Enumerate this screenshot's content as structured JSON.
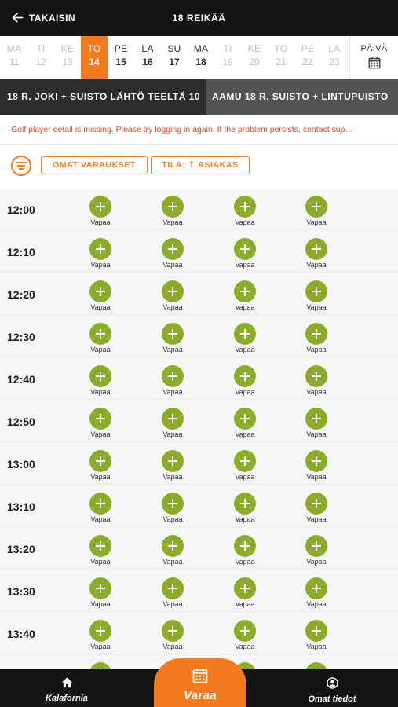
{
  "header": {
    "back_label": "TAKAISIN",
    "title": "18 REIKÄÄ"
  },
  "dates": [
    {
      "day": "MA",
      "date": "11",
      "state": "past"
    },
    {
      "day": "TI",
      "date": "12",
      "state": "past"
    },
    {
      "day": "KE",
      "date": "13",
      "state": "past"
    },
    {
      "day": "TO",
      "date": "14",
      "state": "selected"
    },
    {
      "day": "PE",
      "date": "15",
      "state": "now"
    },
    {
      "day": "LA",
      "date": "16",
      "state": "now"
    },
    {
      "day": "SU",
      "date": "17",
      "state": "now"
    },
    {
      "day": "MA",
      "date": "18",
      "state": "now"
    },
    {
      "day": "TI",
      "date": "19",
      "state": "fut"
    },
    {
      "day": "KE",
      "date": "20",
      "state": "fut"
    },
    {
      "day": "TO",
      "date": "21",
      "state": "fut"
    },
    {
      "day": "PE",
      "date": "22",
      "state": "fut"
    },
    {
      "day": "LA",
      "date": "23",
      "state": "fut"
    }
  ],
  "day_picker_label": "PÄIVÄ",
  "tabs": [
    {
      "label": "18 R. JOKI + SUISTO LÄHTÖ TEELTÄ 10",
      "active": true
    },
    {
      "label": "AAMU 18 R. SUISTO + LINTUPUISTO",
      "active": false
    }
  ],
  "error_message": "Golf player detail is missing. Please try logging in again. If the problem persists, contact sup…",
  "filters": {
    "my_bookings": "OMAT VARAUKSET",
    "status": "TILA: ⇡ ASIAKAS"
  },
  "slot_label": "Vapaa",
  "slots": [
    {
      "time": "12:00",
      "spots": [
        "Vapaa",
        "Vapaa",
        "Vapaa",
        "Vapaa"
      ]
    },
    {
      "time": "12:10",
      "spots": [
        "Vapaa",
        "Vapaa",
        "Vapaa",
        "Vapaa"
      ]
    },
    {
      "time": "12:20",
      "spots": [
        "Vapaa",
        "Vapaa",
        "Vapaa",
        "Vapaa"
      ]
    },
    {
      "time": "12:30",
      "spots": [
        "Vapaa",
        "Vapaa",
        "Vapaa",
        "Vapaa"
      ]
    },
    {
      "time": "12:40",
      "spots": [
        "Vapaa",
        "Vapaa",
        "Vapaa",
        "Vapaa"
      ]
    },
    {
      "time": "12:50",
      "spots": [
        "Vapaa",
        "Vapaa",
        "Vapaa",
        "Vapaa"
      ]
    },
    {
      "time": "13:00",
      "spots": [
        "Vapaa",
        "Vapaa",
        "Vapaa",
        "Vapaa"
      ]
    },
    {
      "time": "13:10",
      "spots": [
        "Vapaa",
        "Vapaa",
        "Vapaa",
        "Vapaa"
      ]
    },
    {
      "time": "13:20",
      "spots": [
        "Vapaa",
        "Vapaa",
        "Vapaa",
        "Vapaa"
      ]
    },
    {
      "time": "13:30",
      "spots": [
        "Vapaa",
        "Vapaa",
        "Vapaa",
        "Vapaa"
      ]
    },
    {
      "time": "13:40",
      "spots": [
        "Vapaa",
        "Vapaa",
        "Vapaa",
        "Vapaa"
      ]
    },
    {
      "time": "",
      "spots": [
        "",
        "",
        "",
        ""
      ]
    }
  ],
  "bottom_nav": {
    "home": "Kalafornia",
    "book": "Varaa",
    "profile": "Omat tiedot"
  },
  "colors": {
    "accent": "#f47a20",
    "available": "#8bac2a",
    "error": "#d9481b",
    "header_bg": "#141414"
  },
  "icons": {
    "back": "arrow-left-icon",
    "calendar": "calendar-icon",
    "filter": "filter-icon",
    "add": "plus-icon",
    "home": "home-icon",
    "profile": "user-icon"
  }
}
